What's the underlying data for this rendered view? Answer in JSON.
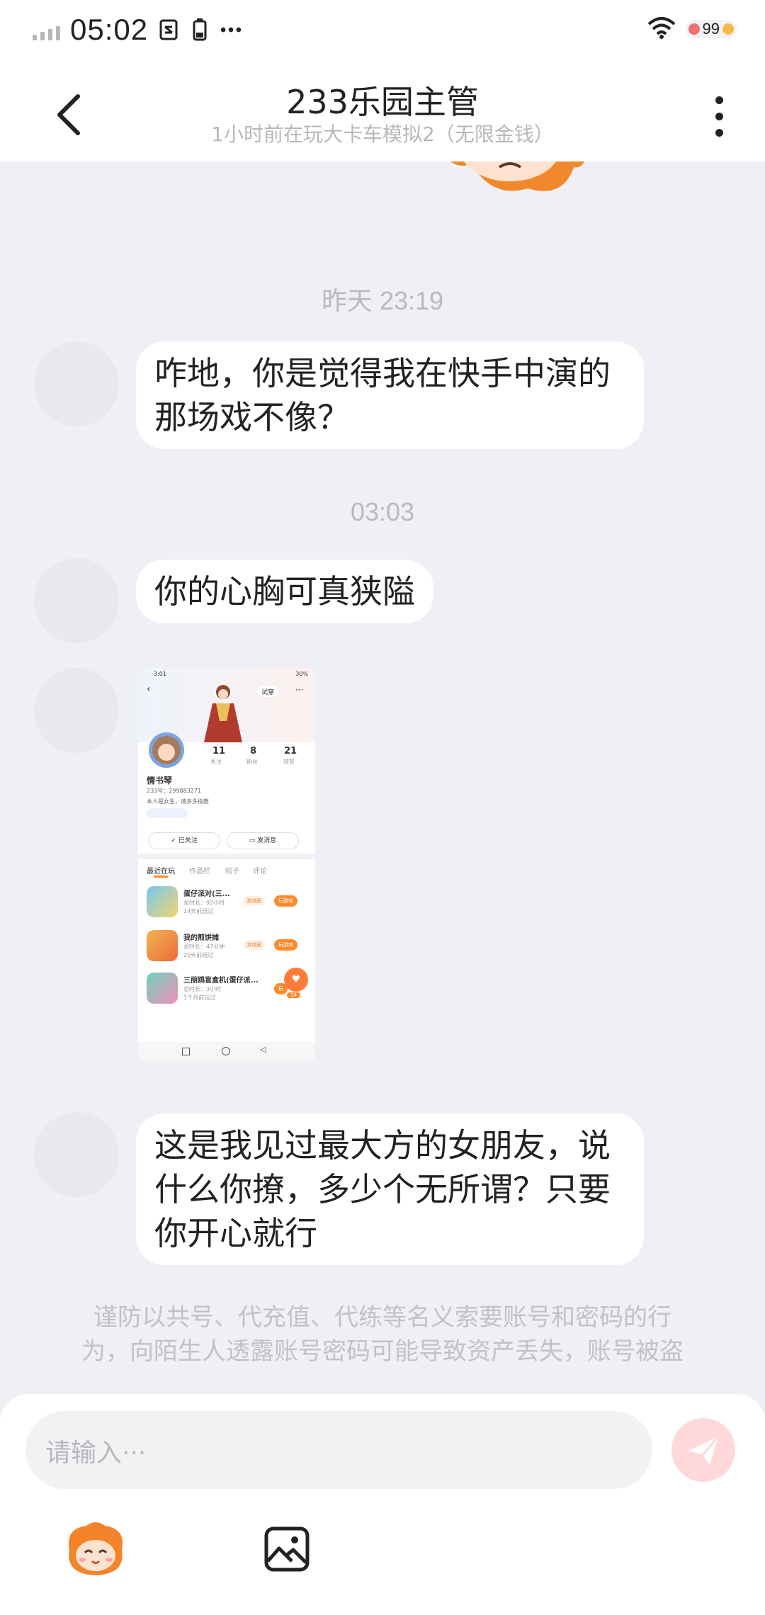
{
  "status_bar": {
    "time": "05:02",
    "battery_level": "99",
    "colors": {
      "battery_red": "#f06f6f",
      "battery_orange": "#f7b94b"
    }
  },
  "header": {
    "title": "233乐园主管",
    "subtitle": "1小时前在玩大卡车模拟2（无限金钱）"
  },
  "messages": [
    {
      "type": "timestamp",
      "text": "昨天 23:19"
    },
    {
      "type": "text",
      "lines": [
        "咋地，你是觉得我在快手中演的",
        "那场戏不像？"
      ]
    },
    {
      "type": "timestamp",
      "text": "03:03"
    },
    {
      "type": "text",
      "lines": [
        "你的心胸可真狭隘"
      ]
    },
    {
      "type": "image",
      "description_labels": {
        "status": "3:01",
        "battery": "30%",
        "try_on": "试穿",
        "stats": [
          {
            "num": "11",
            "label": "关注"
          },
          {
            "num": "8",
            "label": "粉丝"
          },
          {
            "num": "21",
            "label": "获赞"
          }
        ],
        "name": "情书琴",
        "uid": "233号：299883271",
        "bio": "本人是女生，请多多指教",
        "followed": "已关注",
        "send_msg": "发消息",
        "tabs": [
          "最近在玩",
          "作品栏",
          "帖子",
          "评论"
        ],
        "games": [
          {
            "title": "蛋仔派对(三...",
            "meta1": "总时长：92小时",
            "meta2": "14天前玩过",
            "tag": "游戏圈",
            "btn": "玩游戏"
          },
          {
            "title": "我的煎饼摊",
            "meta1": "总时长：47分钟",
            "meta2": "20天前玩过",
            "tag": "游戏圈",
            "btn": "玩游戏"
          },
          {
            "title": "三丽鸥盲盒机(蛋仔派...",
            "meta1": "总时长：3小时",
            "meta2": "1个月前玩过",
            "tag": "",
            "btn": "玩"
          }
        ],
        "like_count": "14"
      }
    },
    {
      "type": "text",
      "lines": [
        "这是我见过最大方的女朋友，说",
        "什么你撩，多少个无所谓？只要",
        "你开心就行"
      ]
    }
  ],
  "notice": {
    "lines": [
      "谨防以共号、代充值、代练等名义索要账号和密码的行",
      "为，向陌生人透露账号密码可能导致资产丢失，账号被盗"
    ]
  },
  "input": {
    "placeholder": "请输入···"
  },
  "icons": {
    "back": "chevron-left-icon",
    "more": "more-vertical-icon",
    "send": "send-icon",
    "emoji": "mascot-emoji-icon",
    "image": "image-icon"
  },
  "colors": {
    "accent": "#ff8a2b",
    "send_disabled": "#ffd9d9",
    "background": "#eef0f5"
  }
}
